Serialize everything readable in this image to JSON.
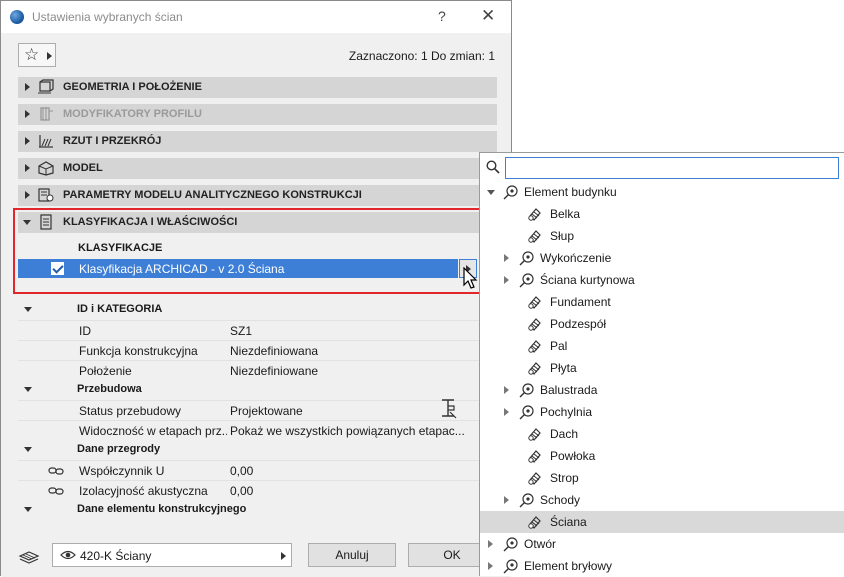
{
  "window": {
    "title": "Ustawienia wybranych ścian",
    "help_glyph": "?",
    "close_glyph": "✕"
  },
  "toolbar": {
    "favorites_glyph": "☆",
    "selection_info": "Zaznaczono: 1 Do zmian: 1"
  },
  "sections": [
    {
      "label": "GEOMETRIA I POŁOŻENIE",
      "expanded": false,
      "enabled": true,
      "icon": "geometry-icon"
    },
    {
      "label": "MODYFIKATORY PROFILU",
      "expanded": false,
      "enabled": false,
      "icon": "profile-modifier-icon"
    },
    {
      "label": "RZUT I PRZEKRÓJ",
      "expanded": false,
      "enabled": true,
      "icon": "floor-plan-section-icon"
    },
    {
      "label": "MODEL",
      "expanded": false,
      "enabled": true,
      "icon": "model-icon"
    },
    {
      "label": "PARAMETRY MODELU ANALITYCZNEGO KONSTRUKCJI",
      "expanded": false,
      "enabled": true,
      "icon": "structural-analytical-icon"
    },
    {
      "label": "KLASYFIKACJA I WŁAŚCIWOŚCI",
      "expanded": true,
      "enabled": true,
      "icon": "classification-icon"
    }
  ],
  "classification": {
    "header": "KLASYFIKACJE",
    "row_label": "Klasyfikacja ARCHICAD - v 2.0 Ściana",
    "checked": true
  },
  "properties": {
    "groups": [
      {
        "label": "ID i KATEGORIA",
        "rows": [
          {
            "name": "ID",
            "value": "SZ1",
            "linked": false
          },
          {
            "name": "Funkcja konstrukcyjna",
            "value": "Niezdefiniowana",
            "linked": false
          },
          {
            "name": "Położenie",
            "value": "Niezdefiniowane",
            "linked": false
          }
        ]
      },
      {
        "label": "Przebudowa",
        "rows": [
          {
            "name": "Status przebudowy",
            "value": "Projektowane",
            "linked": false
          },
          {
            "name": "Widoczność w etapach prz...",
            "value": "Pokaż we wszystkich powiązanych etapac...",
            "linked": false
          }
        ]
      },
      {
        "label": "Dane przegrody",
        "rows": [
          {
            "name": "Współczynnik U",
            "value": "0,00",
            "linked": true
          },
          {
            "name": "Izolacyjność akustyczna",
            "value": "0,00",
            "linked": true
          }
        ]
      },
      {
        "label": "Dane elementu konstrukcyjnego",
        "rows": []
      }
    ]
  },
  "footer": {
    "layer_value": "420-K Ściany",
    "cancel_label": "Anuluj",
    "ok_label": "OK"
  },
  "popup": {
    "search_value": "",
    "items": [
      {
        "label": "Element budynku",
        "level": 0,
        "expander": "down"
      },
      {
        "label": "Belka",
        "level": 1,
        "expander": "none"
      },
      {
        "label": "Słup",
        "level": 1,
        "expander": "none"
      },
      {
        "label": "Wykończenie",
        "level": 1,
        "expander": "right"
      },
      {
        "label": "Ściana kurtynowa",
        "level": 1,
        "expander": "right"
      },
      {
        "label": "Fundament",
        "level": 1,
        "expander": "none"
      },
      {
        "label": "Podzespół",
        "level": 1,
        "expander": "none"
      },
      {
        "label": "Pal",
        "level": 1,
        "expander": "none"
      },
      {
        "label": "Płyta",
        "level": 1,
        "expander": "none"
      },
      {
        "label": "Balustrada",
        "level": 1,
        "expander": "right"
      },
      {
        "label": "Pochylnia",
        "level": 1,
        "expander": "right"
      },
      {
        "label": "Dach",
        "level": 1,
        "expander": "none"
      },
      {
        "label": "Powłoka",
        "level": 1,
        "expander": "none"
      },
      {
        "label": "Strop",
        "level": 1,
        "expander": "none"
      },
      {
        "label": "Schody",
        "level": 1,
        "expander": "right"
      },
      {
        "label": "Ściana",
        "level": 1,
        "expander": "none",
        "selected": true
      },
      {
        "label": "Otwór",
        "level": 0,
        "expander": "right"
      },
      {
        "label": "Element bryłowy",
        "level": 0,
        "expander": "right"
      }
    ]
  },
  "colors": {
    "accent": "#3d7fd6",
    "highlight_frame": "#e0262a",
    "section_header": "#d5d5d5"
  }
}
